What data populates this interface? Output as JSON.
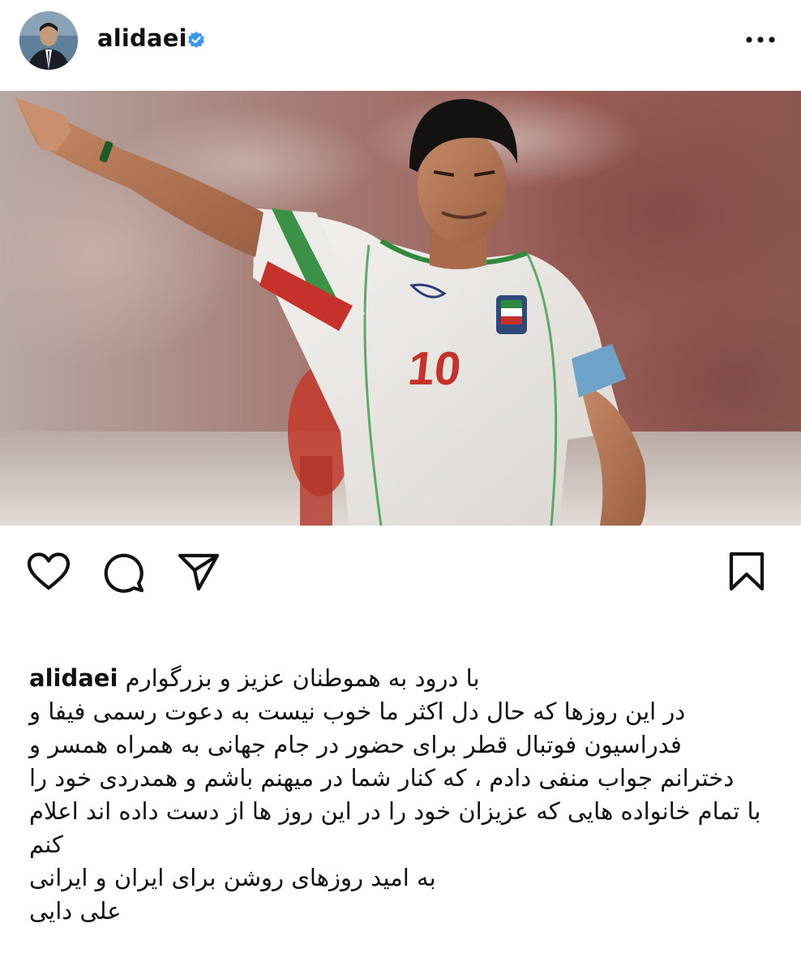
{
  "post": {
    "username": "alidaei",
    "verified": true,
    "avatar_icon": "profile-avatar",
    "more_icon": "more-horizontal-icon",
    "image": {
      "description_icon": "post-photo",
      "jersey_number": "10"
    },
    "actions": {
      "like_icon": "heart-icon",
      "comment_icon": "comment-icon",
      "share_icon": "send-icon",
      "save_icon": "bookmark-icon"
    },
    "caption": {
      "username": "alidaei",
      "first_line": "با درود به هموطنان عزیز و بزرگوارم",
      "lines": [
        "در این روزها که حال دل اکثر ما خوب نیست به دعوت رسمی فیفا و",
        "فدراسیون فوتبال قطر برای حضور در جام جهانی به همراه همسر و",
        "دخترانم جواب منفی دادم ، که کنار شما در میهنم باشم و همدردی خود را",
        "با تمام خانواده هایی که عزیزان خود را در این روز ها از دست داده اند اعلام",
        "کنم",
        "به امید روزهای روشن برای ایران و ایرانی",
        "علی دایی"
      ]
    }
  },
  "colors": {
    "verified_blue": "#3897f0",
    "text": "#111111"
  }
}
